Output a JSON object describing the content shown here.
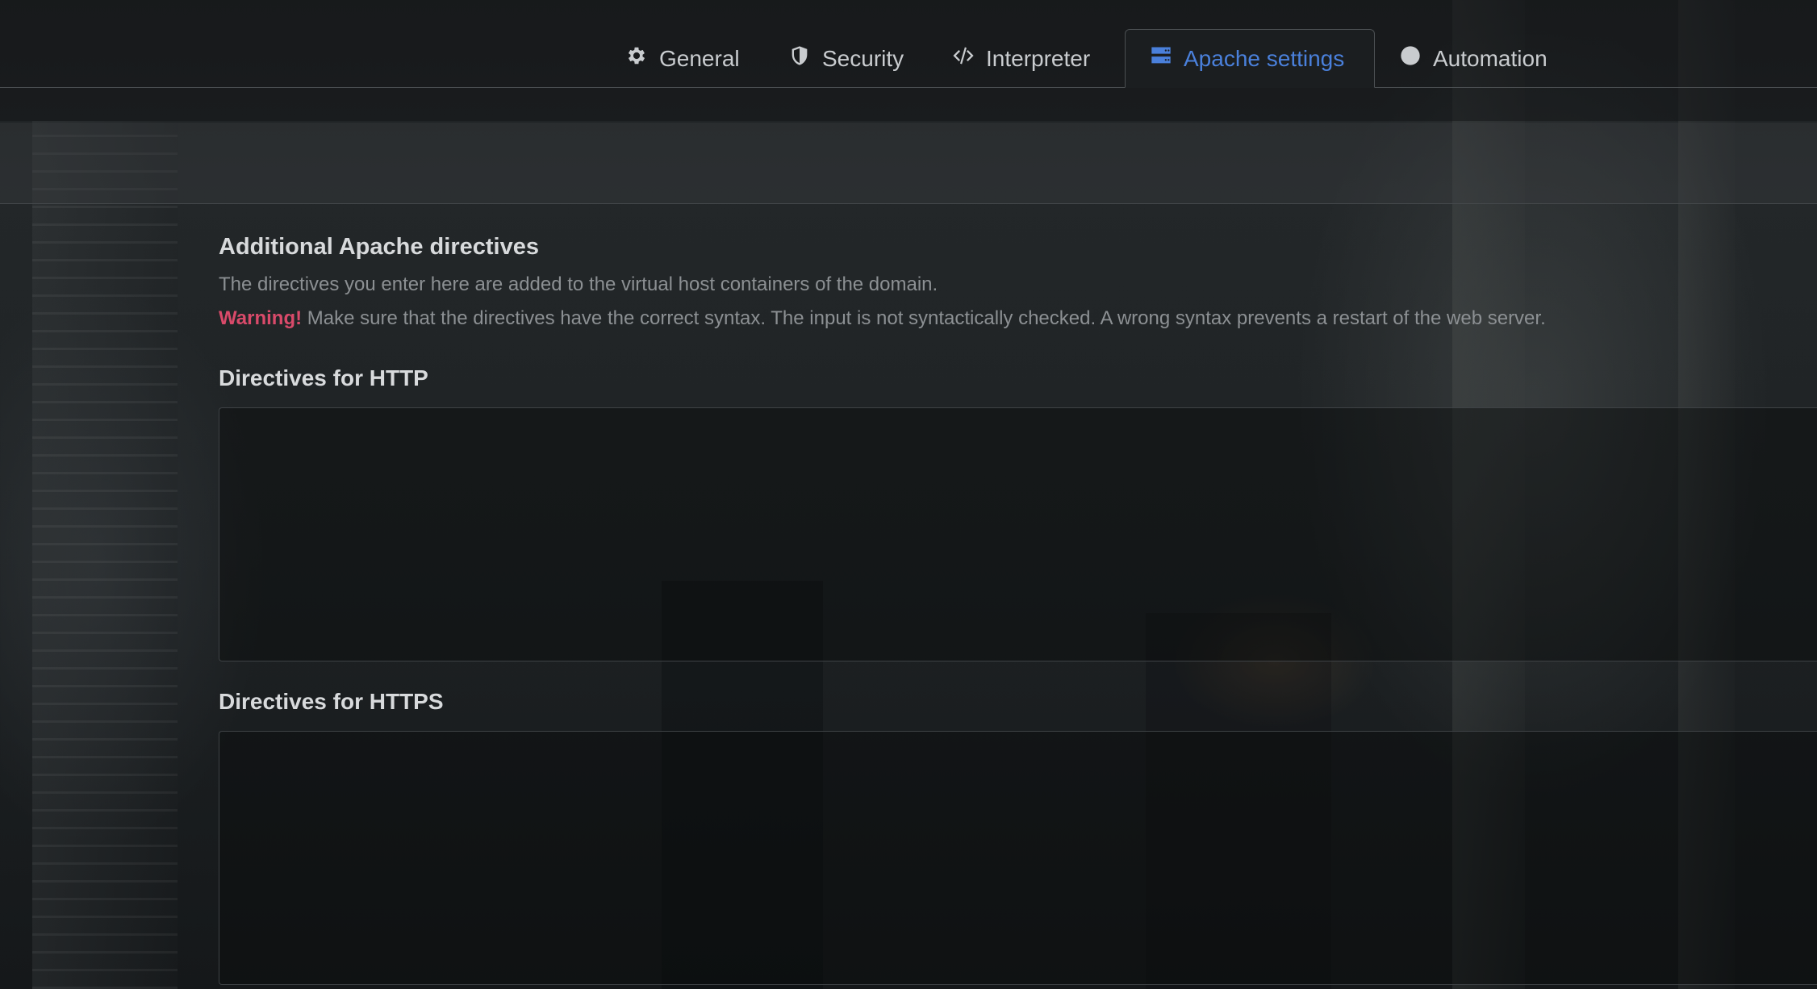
{
  "tabs": [
    {
      "label": "General",
      "icon": "gear-icon",
      "active": false
    },
    {
      "label": "Security",
      "icon": "shield-icon",
      "active": false
    },
    {
      "label": "Interpreter",
      "icon": "code-icon",
      "active": false
    },
    {
      "label": "Apache settings",
      "icon": "server-icon",
      "active": true
    },
    {
      "label": "Automation",
      "icon": "clock-icon",
      "active": false
    }
  ],
  "section": {
    "title": "Additional Apache directives",
    "description": "The directives you enter here are added to the virtual host containers of the domain.",
    "warning_label": "Warning!",
    "warning_text": " Make sure that the directives have the correct syntax. The input is not syntactically checked. A wrong syntax prevents a restart of the web server."
  },
  "fields": {
    "http": {
      "label": "Directives for HTTP",
      "value": ""
    },
    "https": {
      "label": "Directives for HTTPS",
      "value": ""
    }
  },
  "colors": {
    "accent": "#4a80db",
    "warning": "#d94a6a",
    "text": "#c9cccf",
    "muted": "#8c9093"
  }
}
